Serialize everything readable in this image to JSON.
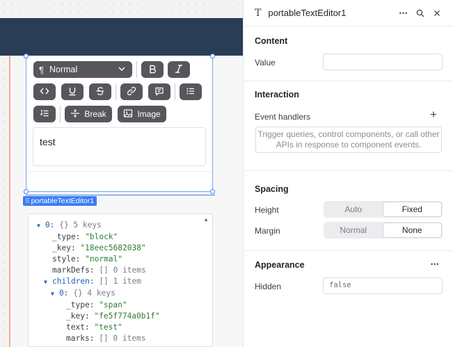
{
  "editor": {
    "style_select": "Normal",
    "break_label": "Break",
    "image_label": "Image",
    "content": "test"
  },
  "component_label": "portableTextEditor1",
  "json_view": {
    "lines": [
      {
        "arrow": "▼",
        "indent": 0,
        "parts": [
          [
            "key",
            "0:"
          ],
          [
            "meta",
            " {} 5 keys"
          ]
        ]
      },
      {
        "arrow": "",
        "indent": 1,
        "parts": [
          [
            "k",
            "_type:"
          ],
          [
            "str",
            " \"block\""
          ]
        ]
      },
      {
        "arrow": "",
        "indent": 1,
        "parts": [
          [
            "k",
            "_key:"
          ],
          [
            "str",
            " \"18eec5682038\""
          ]
        ]
      },
      {
        "arrow": "",
        "indent": 1,
        "parts": [
          [
            "k",
            "style:"
          ],
          [
            "str",
            " \"normal\""
          ]
        ]
      },
      {
        "arrow": "",
        "indent": 1,
        "parts": [
          [
            "k",
            "markDefs:"
          ],
          [
            "meta",
            " [] 0 items"
          ]
        ]
      },
      {
        "arrow": "▼",
        "indent": 1,
        "parts": [
          [
            "key",
            "children:"
          ],
          [
            "meta",
            " [] 1 item"
          ]
        ]
      },
      {
        "arrow": "▼",
        "indent": 2,
        "parts": [
          [
            "key",
            "0:"
          ],
          [
            "meta",
            " {} 4 keys"
          ]
        ]
      },
      {
        "arrow": "",
        "indent": 3,
        "parts": [
          [
            "k",
            "_type:"
          ],
          [
            "str",
            " \"span\""
          ]
        ]
      },
      {
        "arrow": "",
        "indent": 3,
        "parts": [
          [
            "k",
            "_key:"
          ],
          [
            "str",
            " \"fe5f774a0b1f\""
          ]
        ]
      },
      {
        "arrow": "",
        "indent": 3,
        "parts": [
          [
            "k",
            "text:"
          ],
          [
            "str",
            " \"test\""
          ]
        ]
      },
      {
        "arrow": "",
        "indent": 3,
        "parts": [
          [
            "k",
            "marks:"
          ],
          [
            "meta",
            " [] 0 items"
          ]
        ]
      }
    ]
  },
  "panel": {
    "title": "portableTextEditor1",
    "content_title": "Content",
    "value_label": "Value",
    "interaction_title": "Interaction",
    "event_handlers_label": "Event handlers",
    "event_placeholder": "Trigger queries, control components, or call other APIs in response to component events.",
    "spacing_title": "Spacing",
    "height_label": "Height",
    "height_options": [
      "Auto",
      "Fixed"
    ],
    "height_selected": "Fixed",
    "margin_label": "Margin",
    "margin_options": [
      "Normal",
      "None"
    ],
    "margin_selected": "None",
    "appearance_title": "Appearance",
    "hidden_label": "Hidden",
    "hidden_value": "false",
    "more_icon": "•••",
    "add_icon": "+"
  },
  "colors": {
    "appbar": "#293d56",
    "selection": "#3b7df5",
    "toolbar_button": "#55575c"
  }
}
